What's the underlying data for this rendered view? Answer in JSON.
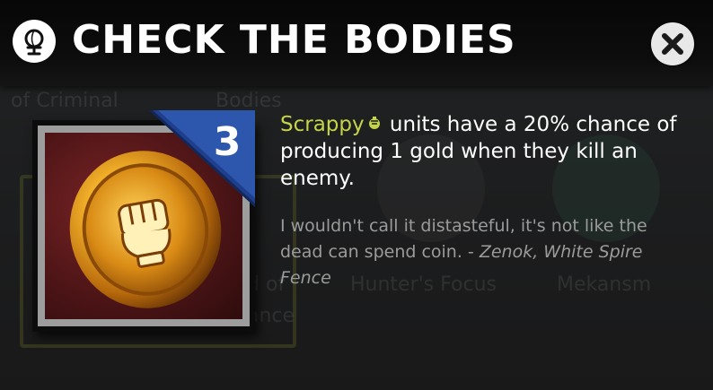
{
  "header": {
    "title": "CHECK THE BODIES",
    "icon": "globe-icon",
    "close_icon": "close-icon"
  },
  "card": {
    "art": "gold-coin-fist-art",
    "tier": "3"
  },
  "description": {
    "keyword": "Scrappy",
    "keyword_icon": "scrappy-icon",
    "text": " units have a 20% chance of producing 1 gold when they kill an enemy."
  },
  "flavor": {
    "quote": "I wouldn't call it distasteful, it's not like the dead can spend coin. - ",
    "attribution": "Zenok, White Spire Fence"
  },
  "background": {
    "labels": [
      "of Criminal",
      "Bodies",
      "d of",
      "ance",
      "Hunter's Focus",
      "Mekansm"
    ]
  },
  "colors": {
    "keyword": "#c5d449",
    "badge": "#1f3e8c",
    "flavor_text": "#9b9b9b"
  }
}
